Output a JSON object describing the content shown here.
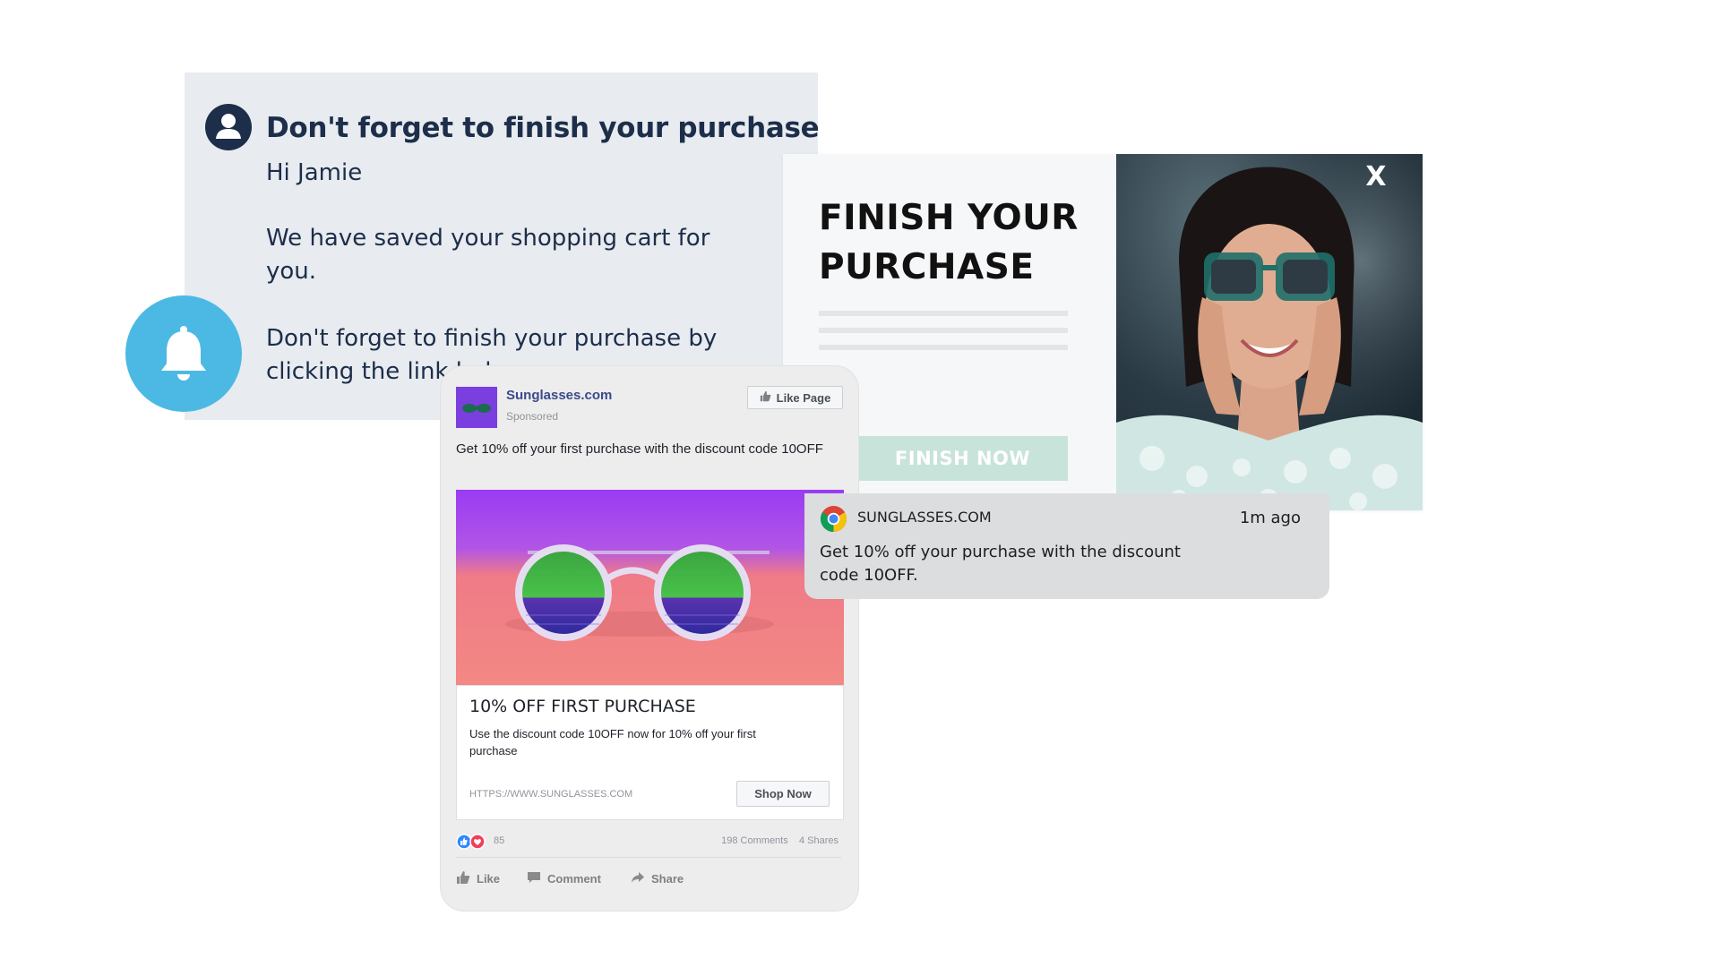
{
  "email": {
    "title": "Don't forget to finish your purchase",
    "greeting": "Hi Jamie",
    "line1": "We have saved your shopping cart for you.",
    "line2": "Don't forget to finish your purchase by clicking the link below."
  },
  "popup": {
    "title": "FINISH YOUR PURCHASE",
    "button_label": "FINISH NOW",
    "close_label": "X"
  },
  "push": {
    "site": "SUNGLASSES.COM",
    "time": "1m ago",
    "body": "Get 10% off your purchase with the discount code 10OFF."
  },
  "facebook_ad": {
    "page_name": "Sunglasses.com",
    "sponsored": "Sponsored",
    "like_page_label": "Like Page",
    "text": "Get 10% off your first purchase with the discount code 10OFF",
    "headline": "10% OFF FIRST PURCHASE",
    "description": "Use the discount code 10OFF now for 10% off your first purchase",
    "url": "HTTPS://WWW.SUNGLASSES.COM",
    "cta_label": "Shop Now",
    "reaction_count": "85",
    "comments": "198 Comments",
    "shares": "4 Shares",
    "actions": {
      "like": "Like",
      "comment": "Comment",
      "share": "Share"
    }
  },
  "colors": {
    "email_bg": "#e8ebef",
    "navy": "#1c2e4a",
    "bell_blue": "#4cb9e4",
    "popup_button": "#c8e3da",
    "push_bg": "#dcdddf",
    "fb_brand_purple": "#7b3fe0"
  },
  "icons": [
    "user-icon",
    "bell-icon",
    "close-icon",
    "chrome-icon",
    "thumbs-up-icon",
    "heart-icon",
    "comment-icon",
    "share-icon"
  ]
}
